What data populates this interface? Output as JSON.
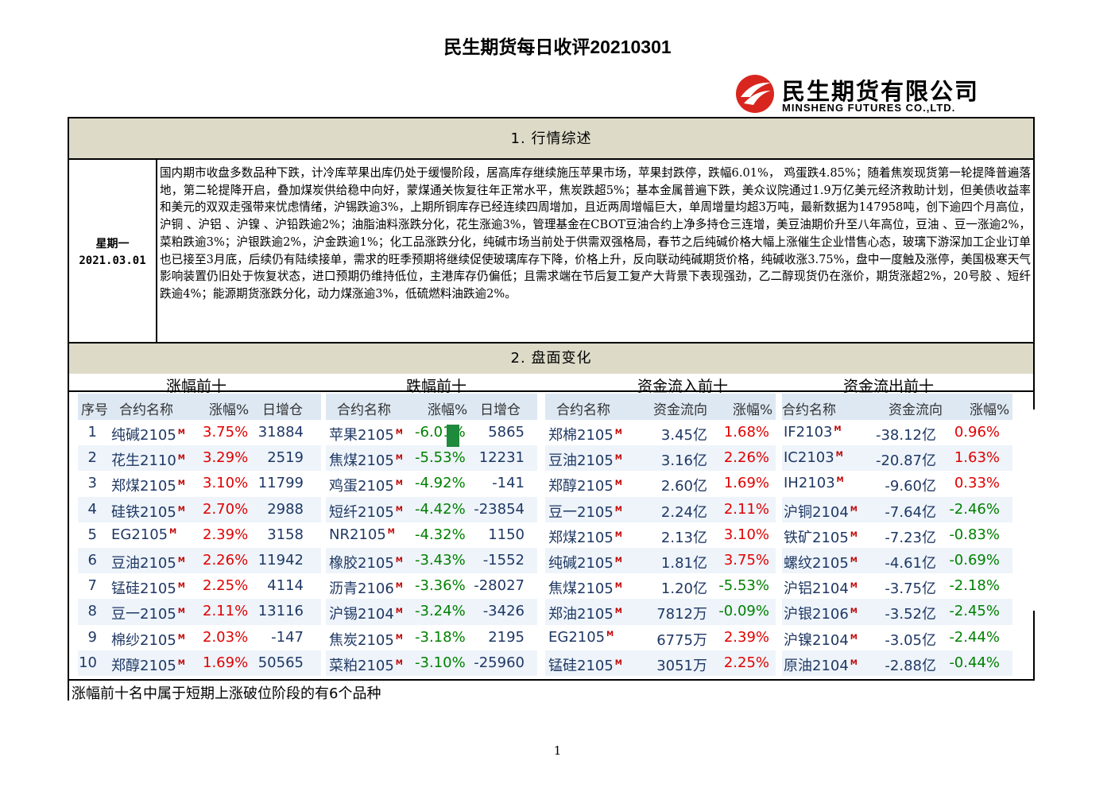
{
  "title": "民生期货每日收评20210301",
  "logo": {
    "cn": "民生期货有限公司",
    "en": "MINSHENG FUTURES CO.,LTD."
  },
  "section1": {
    "heading": "1.  行情综述",
    "weekday": "星期一",
    "date": "2021.03.01",
    "summary": "国内期市收盘多数品种下跌，计冷库苹果出库仍处于缓慢阶段，居高库存继续施压苹果市场，苹果封跌停，跌幅6.01%， 鸡蛋跌4.85%；随着焦炭现货第一轮提降普遍落地，第二轮提降开启，叠加煤炭供给稳中向好，蒙煤通关恢复往年正常水平，焦炭跌超5%；基本金属普遍下跌，美众议院通过1.9万亿美元经济救助计划，但美债收益率和美元的双双走强带来忧虑情绪，沪锡跌逾3%，上期所铜库存已经连续四周增加，且近两周增幅巨大，单周增量均超3万吨，最新数据为147958吨，创下逾四个月高位，沪铜 、沪铝 、沪镍 、沪铅跌逾2%；油脂油料涨跌分化，花生涨逾3%，管理基金在CBOT豆油合约上净多持仓三连增，美豆油期价升至八年高位，豆油 、豆一涨逾2%， 菜粕跌逾3%；沪银跌逾2%，沪金跌逾1%；化工品涨跌分化，纯碱市场当前处于供需双强格局，春节之后纯碱价格大幅上涨催生企业惜售心态，玻璃下游深加工企业订单也已接至3月底，后续仍有陆续接单，需求的旺季预期将继续促使玻璃库存下降，价格上升，反向联动纯碱期货价格，纯碱收涨3.75%，盘中一度触及涨停，美国极寒天气影响装置仍旧处于恢复状态，进口预期仍维持低位，主港库存仍偏低；且需求端在节后复工复产大背景下表现强劲，乙二醇现货仍在涨价，期货涨超2%，20号胶 、短纤跌逾4%；能源期货涨跌分化，动力煤涨逾3%，低硫燃料油跌逾2%。"
  },
  "section2": {
    "heading": "2.  盘面变化",
    "sub_headers": [
      "涨幅前十",
      "跌幅前十",
      "资金流入前十",
      "资金流出前十"
    ],
    "marker": "M",
    "gainers": {
      "headers": [
        "序号",
        "合约名称",
        "涨幅%",
        "日增仓"
      ],
      "rows": [
        [
          "1",
          "纯碱2105",
          "3.75%",
          "31884"
        ],
        [
          "2",
          "花生2110",
          "3.29%",
          "2519"
        ],
        [
          "3",
          "郑煤2105",
          "3.10%",
          "11799"
        ],
        [
          "4",
          "硅铁2105",
          "2.70%",
          "2988"
        ],
        [
          "5",
          "EG2105",
          "2.39%",
          "3158"
        ],
        [
          "6",
          "豆油2105",
          "2.26%",
          "11942"
        ],
        [
          "7",
          "锰硅2105",
          "2.25%",
          "4114"
        ],
        [
          "8",
          "豆一2105",
          "2.11%",
          "13116"
        ],
        [
          "9",
          "棉纱2105",
          "2.03%",
          "-147"
        ],
        [
          "10",
          "郑醇2105",
          "1.69%",
          "50565"
        ]
      ]
    },
    "losers": {
      "headers": [
        "合约名称",
        "涨幅%",
        "日增仓"
      ],
      "rows": [
        [
          "苹果2105",
          "-6.01%",
          "5865"
        ],
        [
          "焦煤2105",
          "-5.53%",
          "12231"
        ],
        [
          "鸡蛋2105",
          "-4.92%",
          "-141"
        ],
        [
          "短纤2105",
          "-4.42%",
          "-23854"
        ],
        [
          "NR2105",
          "-4.32%",
          "1150"
        ],
        [
          "橡胶2105",
          "-3.43%",
          "-1552"
        ],
        [
          "沥青2106",
          "-3.36%",
          "-28027"
        ],
        [
          "沪锡2104",
          "-3.24%",
          "-3426"
        ],
        [
          "焦炭2105",
          "-3.18%",
          "2195"
        ],
        [
          "菜粕2105",
          "-3.10%",
          "-25960"
        ]
      ]
    },
    "inflow": {
      "headers": [
        "合约名称",
        "资金流向",
        "涨幅%"
      ],
      "rows": [
        [
          "郑棉2105",
          "3.45亿",
          "1.68%"
        ],
        [
          "豆油2105",
          "3.16亿",
          "2.26%"
        ],
        [
          "郑醇2105",
          "2.60亿",
          "1.69%"
        ],
        [
          "豆一2105",
          "2.24亿",
          "2.11%"
        ],
        [
          "郑煤2105",
          "2.13亿",
          "3.10%"
        ],
        [
          "纯碱2105",
          "1.81亿",
          "3.75%"
        ],
        [
          "焦煤2105",
          "1.20亿",
          "-5.53%"
        ],
        [
          "郑油2105",
          "7812万",
          "-0.09%"
        ],
        [
          "EG2105",
          "6775万",
          "2.39%"
        ],
        [
          "锰硅2105",
          "3051万",
          "2.25%"
        ]
      ]
    },
    "outflow": {
      "headers": [
        "合约名称",
        "资金流向",
        "涨幅%"
      ],
      "rows": [
        [
          "IF2103",
          "-38.12亿",
          "0.96%"
        ],
        [
          "IC2103",
          "-20.87亿",
          "1.63%"
        ],
        [
          "IH2103",
          "-9.60亿",
          "0.33%"
        ],
        [
          "沪铜2104",
          "-7.64亿",
          "-2.46%"
        ],
        [
          "铁矿2105",
          "-7.23亿",
          "-0.83%"
        ],
        [
          "螺纹2105",
          "-4.61亿",
          "-0.69%"
        ],
        [
          "沪铝2104",
          "-3.75亿",
          "-2.18%"
        ],
        [
          "沪银2106",
          "-3.52亿",
          "-2.45%"
        ],
        [
          "沪镍2104",
          "-3.05亿",
          "-2.44%"
        ],
        [
          "原油2104",
          "-2.88亿",
          "-0.44%"
        ]
      ]
    },
    "note": "涨幅前十名中属于短期上涨破位阶段的有6个品种"
  },
  "page_number": "1",
  "colors": {
    "positive": "#e00000",
    "negative": "#008000",
    "header_bg": "#dddac8",
    "table_header_bg": "#dde8f3",
    "logo_red": "#d8261e"
  }
}
